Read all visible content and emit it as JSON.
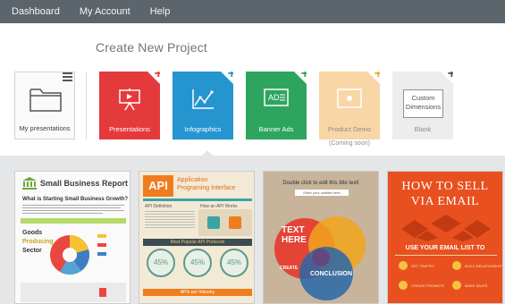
{
  "nav": {
    "items": [
      "Dashboard",
      "My Account",
      "Help"
    ]
  },
  "page_title": "Create New Project",
  "my_presentations": {
    "label": "My presentations"
  },
  "tiles": [
    {
      "label": "Presentations",
      "color": "#e53a3c",
      "plus_color": "#e53a3c",
      "icon": "presentation-board-icon"
    },
    {
      "label": "Infographics",
      "color": "#2595d0",
      "plus_color": "#2595d0",
      "icon": "line-chart-icon"
    },
    {
      "label": "Banner Ads",
      "color": "#2ea55f",
      "plus_color": "#2ea55f",
      "icon": "ad-banner-icon"
    },
    {
      "label": "Product Demo",
      "color": "#f8d6a6",
      "plus_color": "#f5a623",
      "icon": "product-demo-icon",
      "note": "(Coming soon)"
    },
    {
      "label": "Blank",
      "color": "#ededed",
      "plus_color": "#555555",
      "icon": "blank-icon",
      "box_text": "Custom Dimensions"
    }
  ],
  "templates": {
    "t1": {
      "title": "Small Business Report",
      "subtitle": "What is Starting Small Business Growth?",
      "goods": "Goods",
      "producing": "Producing",
      "sector": "Sector"
    },
    "t2": {
      "badge": "API",
      "title_line1": "Application",
      "title_line2": "Programing Interface",
      "api_def": "API Definition",
      "how": "How an API Works",
      "band1": "Most Popular API Protocols",
      "percents": [
        "45%",
        "45%",
        "45%"
      ],
      "band2": "APIs per Industry"
    },
    "t3": {
      "title": "Double click to edit this title text!",
      "subtitle": "Enter your subtitle here",
      "text_here_1": "TEXT",
      "text_here_2": "HERE",
      "create": "CREATE",
      "conclusion": "CONCLUSION"
    },
    "t4": {
      "line1": "HOW TO SELL",
      "line2": "VIA EMAIL",
      "use": "USE YOUR EMAIL LIST TO",
      "features": [
        "GET TRAFFIC",
        "BUILD RELATIONSHIP",
        "CREATE PROMOTE",
        "MAKE SALES"
      ]
    }
  }
}
